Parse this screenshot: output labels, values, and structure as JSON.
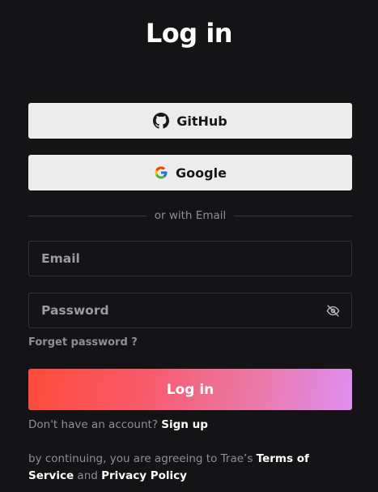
{
  "title": "Log in",
  "oauth": {
    "github_label": "GitHub",
    "google_label": "Google",
    "github_icon": "github-icon",
    "google_icon": "google-icon"
  },
  "divider": {
    "text": "or with Email"
  },
  "form": {
    "email_placeholder": "Email",
    "password_placeholder": "Password",
    "password_toggle_icon": "eye-slash-icon",
    "forget_password_label": "Forget password ?"
  },
  "login_button": {
    "label": "Log in"
  },
  "signup": {
    "prompt": "Don't have an account?",
    "link_label": "Sign up"
  },
  "terms": {
    "prefix": "by continuing, you are agreeing to Trae’s",
    "terms_link": "Terms of Service",
    "conjunction": "and",
    "privacy_link": "Privacy Policy"
  },
  "colors": {
    "background": "#141417",
    "oauth_button_bg": "#ececec",
    "login_gradient_start": "#ff4b3a",
    "login_gradient_end": "#df8ef2",
    "muted_text": "#8e8e95"
  }
}
